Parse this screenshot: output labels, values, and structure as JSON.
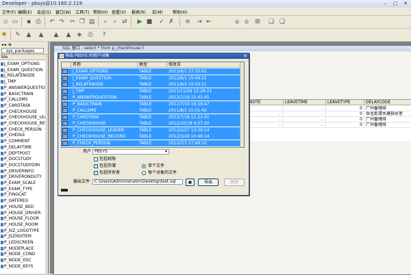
{
  "window": {
    "title": "Developer - pbsys@10.160.2.119"
  },
  "menu": [
    "文件(F)",
    "编辑(E)",
    "会话(S)",
    "窗口(W)",
    "工具(T)",
    "帮助(H)",
    "查看(V)",
    "报表(R)",
    "宏(M)",
    "帮助(H)"
  ],
  "toolbar_icons": [
    "new-icon",
    "open-icon",
    "save-icon",
    "print-icon",
    "undo-icon",
    "redo-icon",
    "cut-icon",
    "copy-icon",
    "paste-icon",
    "find-icon",
    "execute-icon",
    "stop-icon",
    "commit-icon",
    "rollback-icon",
    "explain-icon",
    "help-icon"
  ],
  "left_panel": {
    "selector": "sys_packages",
    "column": "ble",
    "items": [
      "J_EXAM_OPTIONS",
      "J_EXAM_QUESTION",
      "J_RELATENODE",
      "J_TMP",
      "P_ANSWERQUESTION",
      "P_BASICTRAIN",
      "P_CALLSMS",
      "P_CARDTASK",
      "P_CHECKHOUSE",
      "P_CHECKHOUSE_LEAD",
      "P_CHECKHOUSE_REC",
      "P_CHECK_PERSON",
      "P_CHEDUI",
      "P_COMMENT",
      "P_DELAYTIME",
      "P_DEPTPOST",
      "P_DOCSTUDY",
      "P_DOCSTUDYDIRI",
      "P_DRIVERINFO",
      "P_DRIVERONDUTY",
      "P_EXAM_SCALE",
      "P_EXAM_TYPE",
      "P_FINGCAT",
      "P_GATEREG",
      "P_HOUSE_BED",
      "P_HOUSE_DRIVER",
      "P_HOUSE_FLOOR",
      "P_HOUSE_ROOM",
      "P_ISZ_LOGOTYPE",
      "P_JSZHDITEM",
      "P_LEDSCREEN",
      "P_NODEPLACE",
      "P_NODE_COND",
      "P_NODE_DSC",
      "P_NODE_KEYS"
    ]
  },
  "query_window": {
    "title": "SQL 窗口 - select * from p_checkhouse t"
  },
  "result_grid": {
    "columns": [
      "NOTE",
      "LEAVETIME",
      "LEAVETYPE",
      "DELAYCODE"
    ],
    "rows": [
      [
        "",
        "",
        "0",
        "广州番辖排"
      ],
      [
        "",
        "",
        "0",
        "岳北街清水塘指导室"
      ],
      [
        "",
        "",
        "0",
        "广州番辖排"
      ],
      [
        "",
        "",
        "0",
        "广州番辖排"
      ]
    ]
  },
  "dialog": {
    "title": "导出 PBSYS 的用户对象",
    "columns": [
      "名称",
      "类型",
      "修改日"
    ],
    "rows": [
      [
        "J_EXAM_OPTIONS",
        "TABLE",
        "2012/6/1 17:10:01"
      ],
      [
        "J_EXAM_QUESTION",
        "TABLE",
        "2012/6/1 15:44:22"
      ],
      [
        "J_RELATENODE",
        "TABLE",
        "2011/6/3 10:50:21"
      ],
      [
        "J_TMP",
        "TABLE",
        "2011/11/16 12:26:21"
      ],
      [
        "P_ANSWERQUESTION",
        "TABLE",
        "2012/7/19 15:42:45"
      ],
      [
        "P_BASICTRAIN",
        "TABLE",
        "2012/7/19 16:19:47"
      ],
      [
        "P_CALLSMS",
        "TABLE",
        "2011/8/1 15:31:42"
      ],
      [
        "P_CARDTASK",
        "TABLE",
        "2012/7/16 11:12:41"
      ],
      [
        "P_CHECKHOUSE",
        "TABLE",
        "2012/10/19 9:57:20"
      ],
      [
        "P_CHECKHOUSE_LEADER",
        "TABLE",
        "2012/2/27 13:39:14"
      ],
      [
        "P_CHECKHOUSE_RECORD",
        "TABLE",
        "2012/3/28 10:46:14"
      ],
      [
        "P_CHECK_PERSON",
        "TABLE",
        "2012/7/7 17:49:10"
      ]
    ],
    "user_label": "用户",
    "user_value": "PBSYS",
    "checkboxes": [
      {
        "label": "包括权限",
        "checked": false
      },
      {
        "label": "包括存储",
        "checked": true
      },
      {
        "label": "包括所有者",
        "checked": true
      }
    ],
    "radios": [
      {
        "label": "单个文件",
        "selected": true
      },
      {
        "label": "每个对象的文件",
        "selected": false
      }
    ],
    "output_label": "输出文件",
    "output_value": "C:\\Users\\Administrator\\Desktop\\test.sql",
    "export_button": "导出",
    "close_button": "关闭"
  }
}
